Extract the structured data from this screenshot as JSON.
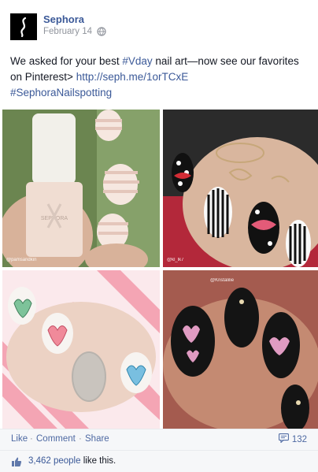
{
  "post": {
    "page_name": "Sephora",
    "date": "February 14",
    "privacy_icon": "globe-icon",
    "text": {
      "part1": "We asked for your best ",
      "hashtag1": "#Vday",
      "part2": " nail art—now see our favorites on Pinterest> ",
      "link": "http://seph.me/1orTCxE",
      "hashtag2": "#SephoraNailspotting"
    }
  },
  "photos": [
    {
      "name": "pink-nail-polish-bottle-photo",
      "watermark": "@pamsandkin"
    },
    {
      "name": "lips-polka-dot-nails-photo",
      "watermark": "@kl_lk7"
    },
    {
      "name": "candy-heart-nails-photo",
      "watermark": ""
    },
    {
      "name": "black-pink-heart-nails-photo",
      "watermark": "@Kristalilie"
    }
  ],
  "actions": {
    "like": "Like",
    "comment": "Comment",
    "share": "Share",
    "separator": "·",
    "comment_count": "132"
  },
  "likes": {
    "count": "3,462 people",
    "suffix": " like this."
  },
  "colors": {
    "link": "#3b5998",
    "action_bg": "#f6f7f9"
  }
}
